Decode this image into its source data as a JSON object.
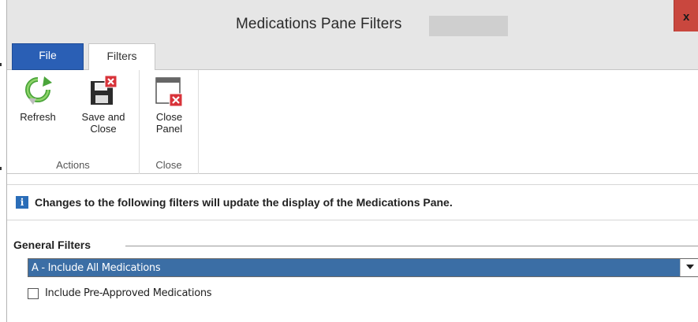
{
  "window": {
    "title": "Medications Pane Filters",
    "close_glyph": "x"
  },
  "tabs": [
    {
      "label": "File",
      "active": false,
      "color": "#2a5fb5"
    },
    {
      "label": "Filters",
      "active": true
    }
  ],
  "ribbon": {
    "groups": [
      {
        "label": "Actions",
        "buttons": [
          {
            "label": "Refresh",
            "icon": "refresh-icon"
          },
          {
            "label": "Save and\nClose",
            "icon": "save-close-icon"
          }
        ]
      },
      {
        "label": "Close",
        "buttons": [
          {
            "label": "Close\nPanel",
            "icon": "close-panel-icon"
          }
        ]
      }
    ]
  },
  "info": {
    "icon": "info-icon",
    "text": "Changes to the following filters will update the display of the Medications Pane."
  },
  "general_filters": {
    "title": "General Filters",
    "select": {
      "selected": "A - Include All Medications"
    },
    "checkbox": {
      "label": "Include Pre-Approved Medications",
      "checked": false
    }
  },
  "colors": {
    "accent": "#2a5fb5",
    "selection": "#3b6ea5",
    "close_button": "#c9473e"
  }
}
